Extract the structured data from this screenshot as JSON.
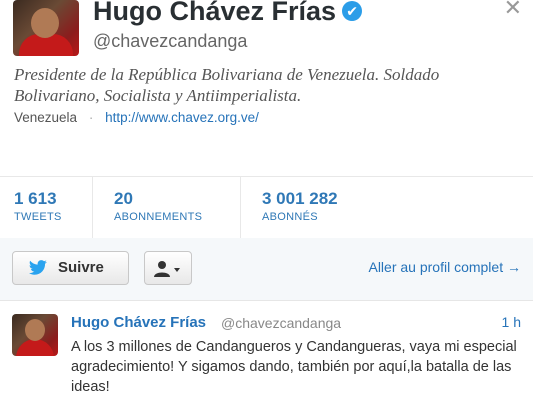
{
  "profile": {
    "name": "Hugo Chávez Frías",
    "handle": "@chavezcandanga",
    "bio": "Presidente de la República Bolivariana de Venezuela. Soldado Bolivariano, Socialista y Antiimperialista.",
    "location": "Venezuela",
    "separator": "·",
    "website": "http://www.chavez.org.ve/",
    "verified_icon": "✔",
    "close_icon": "✕"
  },
  "stats": [
    {
      "value": "1 613",
      "label": "TWEETS"
    },
    {
      "value": "20",
      "label": "ABONNEMENTS"
    },
    {
      "value": "3 001 282",
      "label": "ABONNÉS"
    }
  ],
  "actions": {
    "follow_label": "Suivre",
    "profile_link": "Aller au profil complet →"
  },
  "tweet": {
    "name": "Hugo Chávez Frías",
    "handle": "@chavezcandanga",
    "time": "1 h",
    "text": "A los 3 millones de Candangueros y Candangueras, vaya mi especial agradecimiento! Y sigamos dando, también por aquí,la batalla de las ideas!"
  },
  "colors": {
    "link": "#2673b9",
    "verified": "#2b9de8",
    "twitter_bird": "#2aa3ef"
  }
}
